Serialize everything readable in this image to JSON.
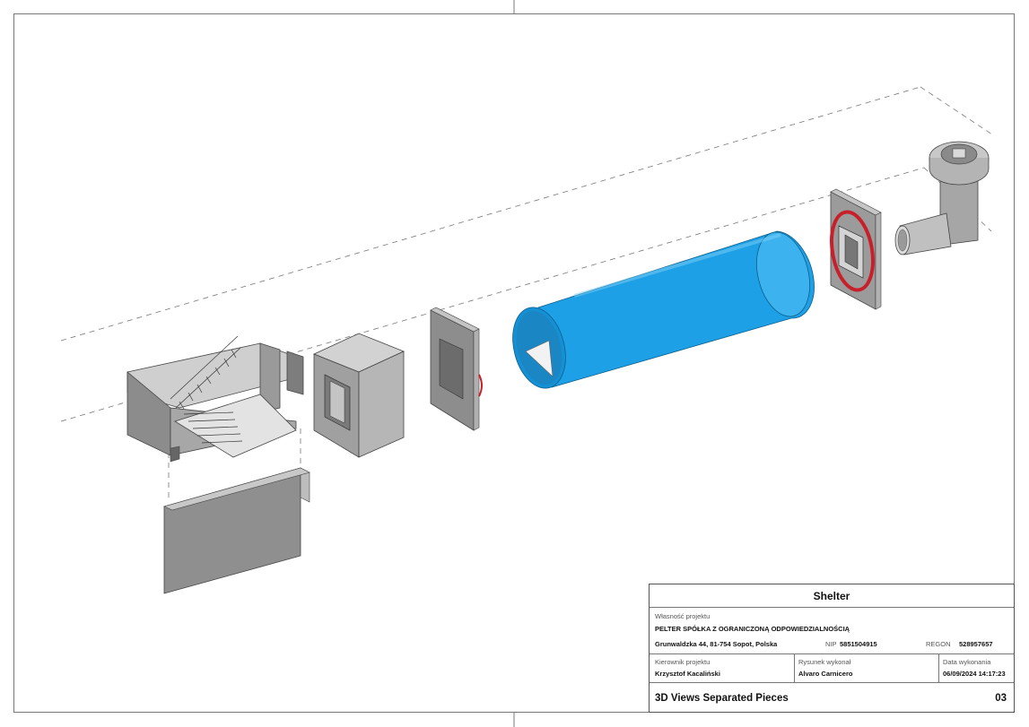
{
  "title_block": {
    "project_name": "Shelter",
    "owner_label": "Własność projektu",
    "owner_name": "PELTER SPÓŁKA Z OGRANICZONĄ ODPOWIEDZIALNOŚCIĄ",
    "address": "Grunwaldzka 44, 81-754 Sopot, Polska",
    "nip_label": "NIP",
    "nip_value": "5851504915",
    "regon_label": "REGON",
    "regon_value": "528957657",
    "manager_label": "Kierownik projektu",
    "manager_name": "Krzysztof Kacaliński",
    "drawn_by_label": "Rysunek wykonał",
    "drawn_by_name": "Alvaro Carnicero",
    "date_label": "Data wykonania",
    "date_value": "06/09/2024 14:17:23",
    "sheet_title": "3D Views Separated Pieces",
    "sheet_number": "03"
  },
  "colors": {
    "pipe_blue": "#1ea0e6",
    "gasket_red": "#c8202a",
    "concrete_gray": "#9a9a9a",
    "line": "#555555"
  }
}
